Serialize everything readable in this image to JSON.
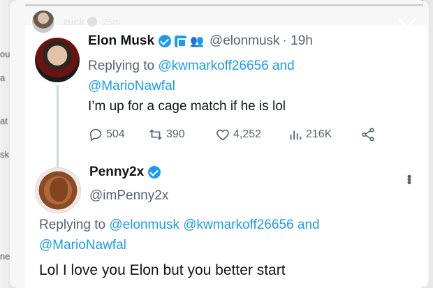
{
  "story": {
    "username": "zuck",
    "time": "25m"
  },
  "background": {
    "fragments": [
      "ou",
      "a",
      "at",
      "sk",
      "ne"
    ]
  },
  "tweet1": {
    "name": "Elon Musk",
    "handle": "@elonmusk",
    "time": "· 19h",
    "replying_prefix": "Replying to ",
    "mention1": "@kwmarkoff26656",
    "and": " and",
    "mention2": "@MarioNawfal",
    "body": "I’m up for a cage match if he is lol",
    "replies": "504",
    "retweets": "390",
    "likes": "4,252",
    "views": "216K"
  },
  "tweet2": {
    "name": "Penny2x",
    "handle": "@imPenny2x",
    "replying_prefix": "Replying to ",
    "mention1": "@elonmusk",
    "mention2": "@kwmarkoff26656",
    "and": " and",
    "mention3": "@MarioNawfal",
    "body": "Lol I love you Elon but you better start"
  },
  "colors": {
    "accent": "#1d9bf0",
    "text": "#0f1419",
    "secondary": "#536471"
  }
}
